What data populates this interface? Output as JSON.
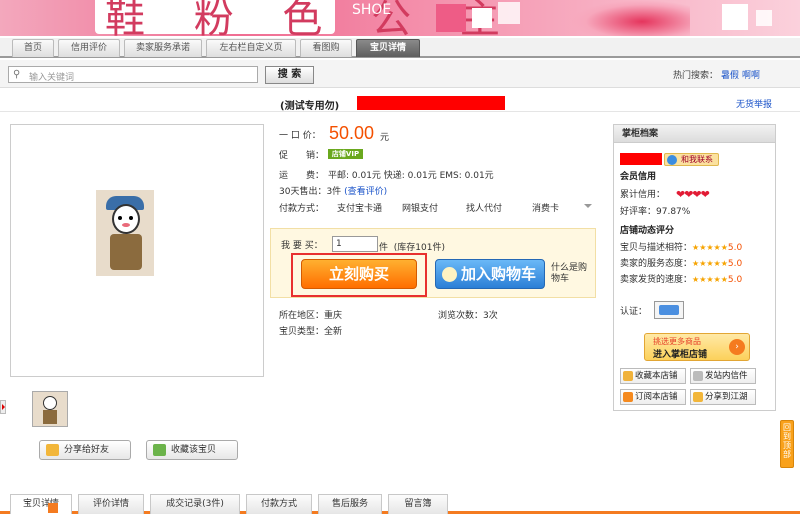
{
  "banner": {
    "brand_text": "鞋 粉 色 公 主",
    "shoe_text": "SHOE"
  },
  "nav_tabs": [
    {
      "label": "首页"
    },
    {
      "label": "信用评价"
    },
    {
      "label": "卖家服务承诺"
    },
    {
      "label": "左右栏自定义页"
    },
    {
      "label": "看图购"
    },
    {
      "label": "宝贝详情",
      "active": true
    }
  ],
  "search": {
    "placeholder": "输入关键词",
    "button": "搜 索",
    "hot_label": "热门搜索：",
    "hot_links": [
      "暑假",
      "啊啊"
    ]
  },
  "product": {
    "title": "(测试专用勿)",
    "report": "无货举报",
    "price_label": "一 口 价：",
    "price": "50.00",
    "currency": "元",
    "promo_label": "促　　销：",
    "promo_badge": "店铺VIP",
    "shipping_label": "运　　费：",
    "shipping": "平邮: 0.01元 快递: 0.01元 EMS: 0.01元",
    "sold": "30天售出：3件",
    "review_link": "(查看评价)",
    "pay_label": "付款方式：",
    "pay_options": [
      "支付宝卡通",
      "网银支付",
      "找人代付",
      "消费卡"
    ],
    "qty_label": "我 要 买：",
    "qty_value": "1",
    "qty_unit": "件",
    "stock": "(库存101件)",
    "buy_now": "立刻购买",
    "add_cart": "加入购物车",
    "cart_help": "什么是购物车",
    "location_label": "所在地区：重庆",
    "views": "浏览次数：3次",
    "type_label": "宝贝类型：全新",
    "share": "分享给好友",
    "collect": "收藏该宝贝"
  },
  "shop": {
    "header": "掌柜档案",
    "contact": "和我联系",
    "member_credit": "会员信用",
    "cumulative": "累计信用：",
    "good_rate": "好评率：97.87%",
    "dynamic_title": "店铺动态评分",
    "ratings": [
      {
        "label": "宝贝与描述相符：",
        "stars": "★★★★★",
        "score": "5.0"
      },
      {
        "label": "卖家的服务态度：",
        "stars": "★★★★★",
        "score": "5.0"
      },
      {
        "label": "卖家发货的速度：",
        "stars": "★★★★★",
        "score": "5.0"
      }
    ],
    "auth": "认证：",
    "enter_top": "挑选更多商品",
    "enter_bottom": "进入掌柜店铺",
    "btn_collect_shop": "收藏本店铺",
    "btn_message": "发站内信件",
    "btn_subscribe": "订阅本店铺",
    "btn_share_jh": "分享到江湖"
  },
  "totop": "回到顶部",
  "bottom_tabs": [
    {
      "label": "宝贝详情",
      "active": true
    },
    {
      "label": "评价详情"
    },
    {
      "label": "成交记录(3件)"
    },
    {
      "label": "付款方式"
    },
    {
      "label": "售后服务"
    },
    {
      "label": "留言簿"
    }
  ]
}
